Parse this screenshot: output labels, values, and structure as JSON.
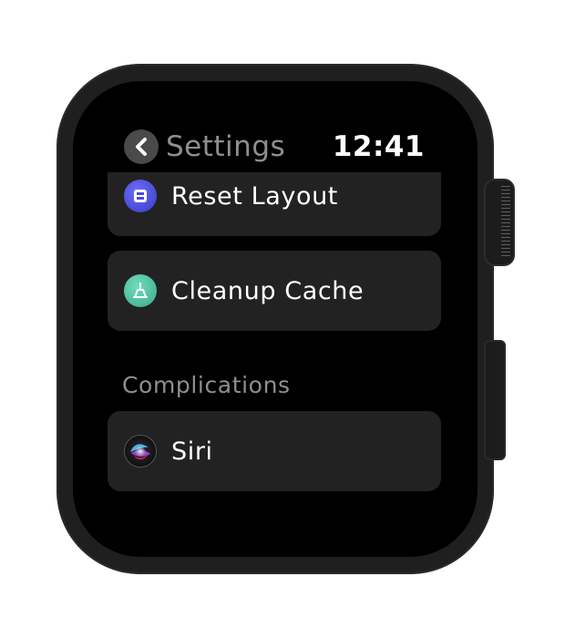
{
  "header": {
    "back_title": "Settings",
    "time": "12:41"
  },
  "list": {
    "items": [
      {
        "label": "Reset Layout",
        "icon": "reset-layout-icon",
        "icon_color": "#4b4bdc"
      },
      {
        "label": "Cleanup Cache",
        "icon": "broom-icon",
        "icon_color": "#4cc2a0"
      }
    ],
    "section_header": "Complications",
    "complications": [
      {
        "label": "Siri",
        "icon": "siri-icon"
      }
    ]
  },
  "colors": {
    "screen_background": "#000000",
    "row_background": "#222222",
    "secondary_text": "#8e8e93",
    "case": "#1f1f1f"
  }
}
